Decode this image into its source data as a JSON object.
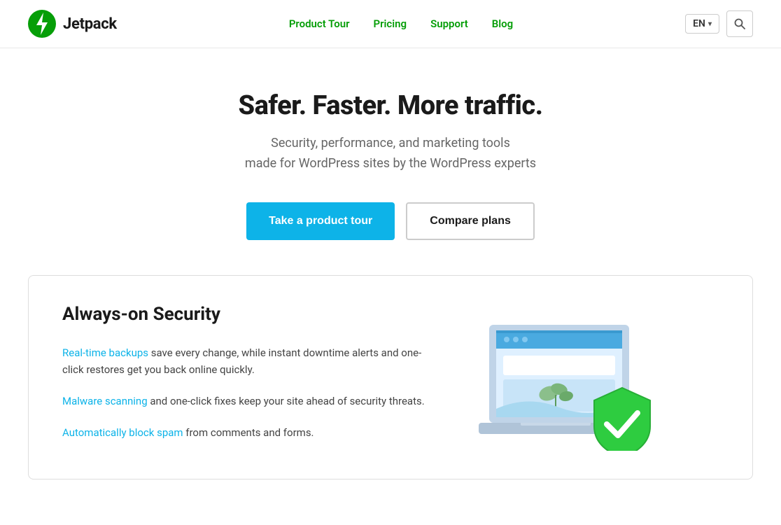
{
  "header": {
    "logo_text": "Jetpack",
    "nav": {
      "product_tour": "Product Tour",
      "pricing": "Pricing",
      "support": "Support",
      "blog": "Blog"
    },
    "lang": "EN",
    "search_icon_char": "🔍"
  },
  "hero": {
    "title": "Safer. Faster. More traffic.",
    "subtitle_line1": "Security, performance, and marketing tools",
    "subtitle_line2": "made for WordPress sites by the WordPress experts",
    "btn_primary": "Take a product tour",
    "btn_secondary": "Compare plans"
  },
  "security_card": {
    "title": "Always-on Security",
    "paragraph1_link": "Real-time backups",
    "paragraph1_text": " save every change, while instant downtime alerts and one-click restores get you back online quickly.",
    "paragraph2_link": "Malware scanning",
    "paragraph2_text": " and one-click fixes keep your site ahead of security threats.",
    "paragraph3_link": "Automatically block spam",
    "paragraph3_text": " from comments and forms."
  },
  "colors": {
    "green": "#069e08",
    "blue": "#0db3e8",
    "shield_green": "#2ecc40",
    "laptop_body": "#b0c4d8",
    "laptop_screen_bg": "#5bb8f5",
    "laptop_inner": "#dff0ff"
  }
}
